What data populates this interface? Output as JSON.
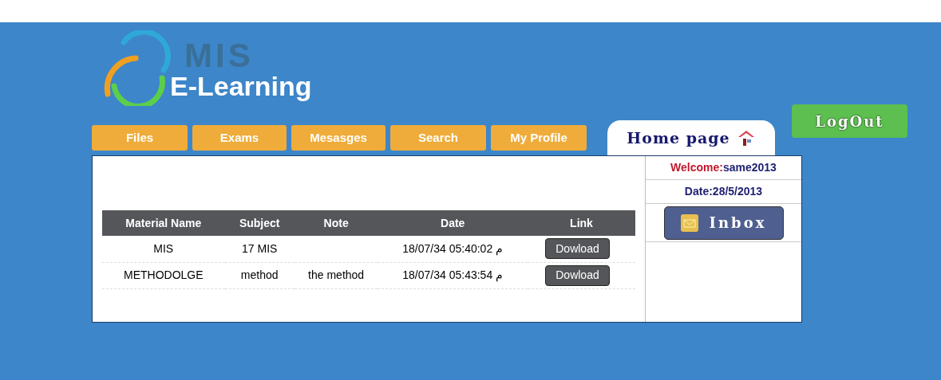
{
  "logo": {
    "top": "MIS",
    "bottom": "E-Learning"
  },
  "nav": [
    {
      "label": "Files",
      "selected": false
    },
    {
      "label": "Exams",
      "selected": false
    },
    {
      "label": "Mesasges",
      "selected": false
    },
    {
      "label": "Search",
      "selected": false
    },
    {
      "label": "My Profile",
      "selected": false
    },
    {
      "label": "Home page",
      "selected": true
    }
  ],
  "logout": "LogOut",
  "table": {
    "columns": [
      "Material Name",
      "Subject",
      "Note",
      "Date",
      "Link"
    ],
    "rows": [
      {
        "material": "MIS",
        "subject": "17 MIS",
        "date": "18/07/34 05:40:02 م",
        "link": "Dowload"
      },
      {
        "material": "METHODOLGE",
        "subject": "method",
        "note": "the method",
        "date": "18/07/34 05:43:54 م",
        "link": "Dowload"
      }
    ]
  },
  "sidebar": {
    "welcome_label": "Welcome:",
    "user": "same2013",
    "date": "Date:28/5/2013",
    "inbox": "Inbox"
  }
}
